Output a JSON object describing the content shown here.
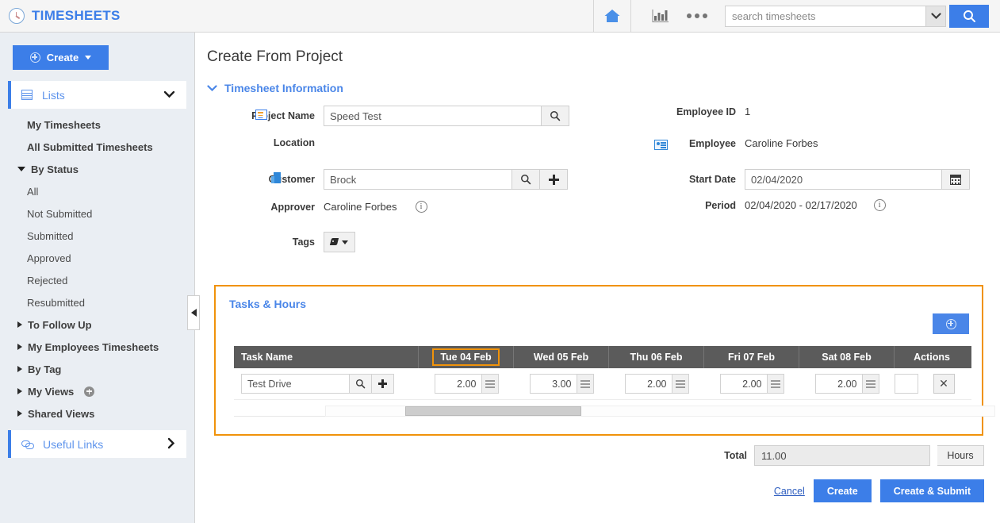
{
  "app": {
    "brand": "TIMESHEETS",
    "brand_color": "#3c7ee8",
    "accent_orange": "#f0920a"
  },
  "topbar": {
    "home_icon": "home-icon",
    "chart_icon": "bar-chart-icon",
    "more_icon": "ellipsis-icon",
    "search_placeholder": "search timesheets",
    "search_value": "",
    "search_icon": "search-icon",
    "dropdown_icon": "chevron-down-icon"
  },
  "sidebar": {
    "create_label": "Create",
    "lists_label": "Lists",
    "items": [
      {
        "label": "My Timesheets",
        "style": "bold"
      },
      {
        "label": "All Submitted Timesheets",
        "style": "bold"
      }
    ],
    "by_status_label": "By Status",
    "status_items": [
      {
        "label": "All"
      },
      {
        "label": "Not Submitted"
      },
      {
        "label": "Submitted"
      },
      {
        "label": "Approved"
      },
      {
        "label": "Rejected"
      },
      {
        "label": "Resubmitted"
      }
    ],
    "groups": [
      {
        "label": "To Follow Up"
      },
      {
        "label": "My Employees Timesheets"
      },
      {
        "label": "By Tag"
      },
      {
        "label": "My Views"
      },
      {
        "label": "Shared Views"
      }
    ],
    "useful_links_label": "Useful Links"
  },
  "main": {
    "page_title": "Create From Project",
    "section_title": "Timesheet Information",
    "fields": {
      "project_name_label": "Project Name",
      "project_name_value": "Speed Test",
      "location_label": "Location",
      "location_value": "",
      "customer_label": "Customer",
      "customer_value": "Brock",
      "approver_label": "Approver",
      "approver_value": "Caroline Forbes",
      "tags_label": "Tags",
      "employee_id_label": "Employee ID",
      "employee_id_value": "1",
      "employee_label": "Employee",
      "employee_value": "Caroline Forbes",
      "start_date_label": "Start Date",
      "start_date_value": "02/04/2020",
      "period_label": "Period",
      "period_value": "02/04/2020 - 02/17/2020"
    }
  },
  "tasks": {
    "title": "Tasks & Hours",
    "add_button_icon": "plus-circle-icon",
    "columns": {
      "task_name": "Task Name",
      "days": [
        "Tue 04 Feb",
        "Wed 05 Feb",
        "Thu 06 Feb",
        "Fri 07 Feb",
        "Sat 08 Feb"
      ],
      "actions": "Actions"
    },
    "selected_column": "Tue 04 Feb",
    "rows": [
      {
        "task_name": "Test Drive",
        "hours": [
          "2.00",
          "3.00",
          "2.00",
          "2.00",
          "2.00"
        ],
        "delete_label": "✕"
      }
    ]
  },
  "footer": {
    "total_label": "Total",
    "total_value": "11.00",
    "total_unit": "Hours",
    "cancel_label": "Cancel",
    "create_label": "Create",
    "create_submit_label": "Create & Submit"
  }
}
